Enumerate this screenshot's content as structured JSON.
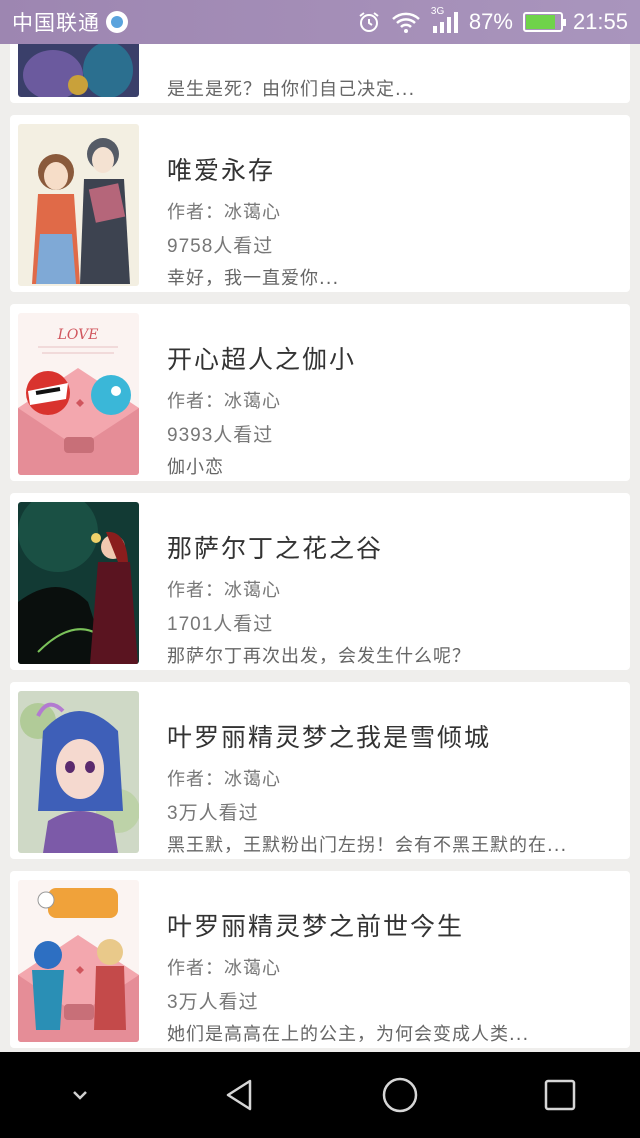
{
  "status_bar": {
    "carrier": "中国联通",
    "network": "3G",
    "battery_percent": "87%",
    "battery_level": 0.87,
    "time": "21:55"
  },
  "books": [
    {
      "title": "",
      "author": "",
      "views": "",
      "desc": "是生是死？由你们自己决定..."
    },
    {
      "title": "唯爱永存",
      "author": "作者：冰蔼心",
      "views": "9758人看过",
      "desc": "幸好，我一直爱你..."
    },
    {
      "title": "开心超人之伽小",
      "author": "作者：冰蔼心",
      "views": "9393人看过",
      "desc": "伽小恋"
    },
    {
      "title": "那萨尔丁之花之谷",
      "author": "作者：冰蔼心",
      "views": "1701人看过",
      "desc": "那萨尔丁再次出发，会发生什么呢？"
    },
    {
      "title": "叶罗丽精灵梦之我是雪倾城",
      "author": "作者：冰蔼心",
      "views": "3万人看过",
      "desc": "黑王默，王默粉出门左拐！会有不黑王默的在..."
    },
    {
      "title": "叶罗丽精灵梦之前世今生",
      "author": "作者：冰蔼心",
      "views": "3万人看过",
      "desc": "她们是高高在上的公主，为何会变成人类..."
    }
  ],
  "covers": {
    "c2_text": "LOVE"
  },
  "nav": {
    "down": "chevron-down-icon",
    "back": "back-triangle-icon",
    "home": "home-circle-icon",
    "recent": "recent-square-icon"
  },
  "colors": {
    "status_bar": "#a58fb8",
    "background": "#efeeec",
    "battery_fill": "#6fd34a"
  }
}
